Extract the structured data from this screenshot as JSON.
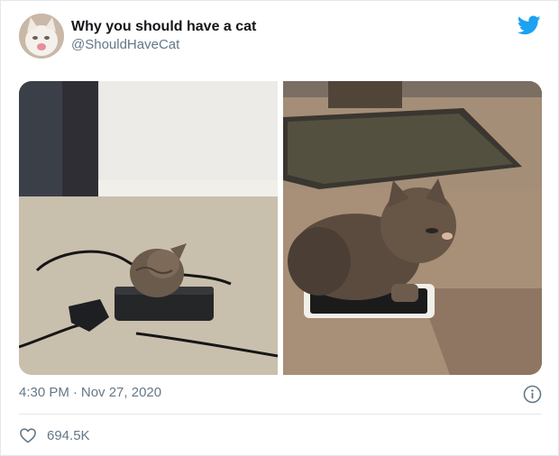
{
  "tweet": {
    "author": {
      "display_name": "Why you should have a cat",
      "handle": "@ShouldHaveCat",
      "avatar": "kitten-avatar"
    },
    "brand_icon": "twitter-bird-icon",
    "brand_color": "#1da1f2",
    "media": [
      {
        "name": "kitten-sleeping-on-laptop-charger"
      },
      {
        "name": "kitten-lying-on-smartphone"
      }
    ],
    "time": "4:30 PM",
    "separator": "·",
    "date": "Nov 27, 2020",
    "info_icon": "info-icon",
    "likes": {
      "icon": "heart-icon",
      "count": "694.5K"
    }
  },
  "colors": {
    "primary_text": "#14171a",
    "secondary_text": "#657786",
    "divider": "#e1e8ed"
  }
}
